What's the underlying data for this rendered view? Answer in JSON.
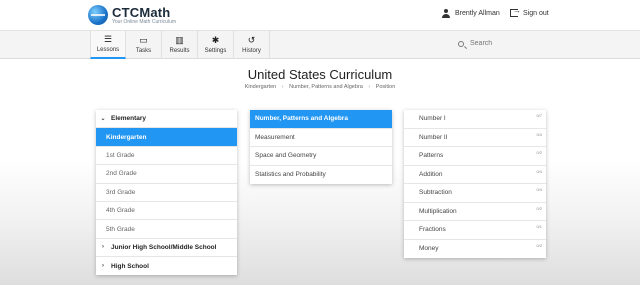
{
  "app": {
    "logo_title": "CTCMath",
    "logo_subtitle": "Your Online Math Curriculum"
  },
  "header": {
    "user_name": "Brently Allman",
    "sign_out": "Sign out"
  },
  "nav": {
    "items": [
      {
        "label": "Lessons",
        "icon": "list-icon",
        "glyph": "☰"
      },
      {
        "label": "Tasks",
        "icon": "tasks-icon",
        "glyph": "▭"
      },
      {
        "label": "Results",
        "icon": "bar-chart-icon",
        "glyph": "▥"
      },
      {
        "label": "Settings",
        "icon": "gear-icon",
        "glyph": "✱"
      },
      {
        "label": "History",
        "icon": "history-icon",
        "glyph": "↺"
      }
    ],
    "search_placeholder": "Search"
  },
  "page": {
    "title": "United States Curriculum",
    "breadcrumb": [
      "Kindergarten",
      "Number, Patterns and Algebra",
      "Position"
    ]
  },
  "levels": {
    "elementary": "Elementary",
    "grades": [
      "Kindergarten",
      "1st Grade",
      "2nd Grade",
      "3rd Grade",
      "4th Grade",
      "5th Grade"
    ],
    "junior": "Junior High School/Middle School",
    "high": "High School"
  },
  "strands": [
    "Number, Patterns and Algebra",
    "Measurement",
    "Space and Geometry",
    "Statistics and Probability"
  ],
  "topics": [
    {
      "label": "Number I",
      "progress": "0/7"
    },
    {
      "label": "Number II",
      "progress": "0/4"
    },
    {
      "label": "Patterns",
      "progress": "0/2"
    },
    {
      "label": "Addition",
      "progress": "0/4"
    },
    {
      "label": "Subtraction",
      "progress": "0/4"
    },
    {
      "label": "Multiplication",
      "progress": "0/2"
    },
    {
      "label": "Fractions",
      "progress": "0/1"
    },
    {
      "label": "Money",
      "progress": "0/2"
    }
  ],
  "colors": {
    "accent": "#2196f3"
  }
}
